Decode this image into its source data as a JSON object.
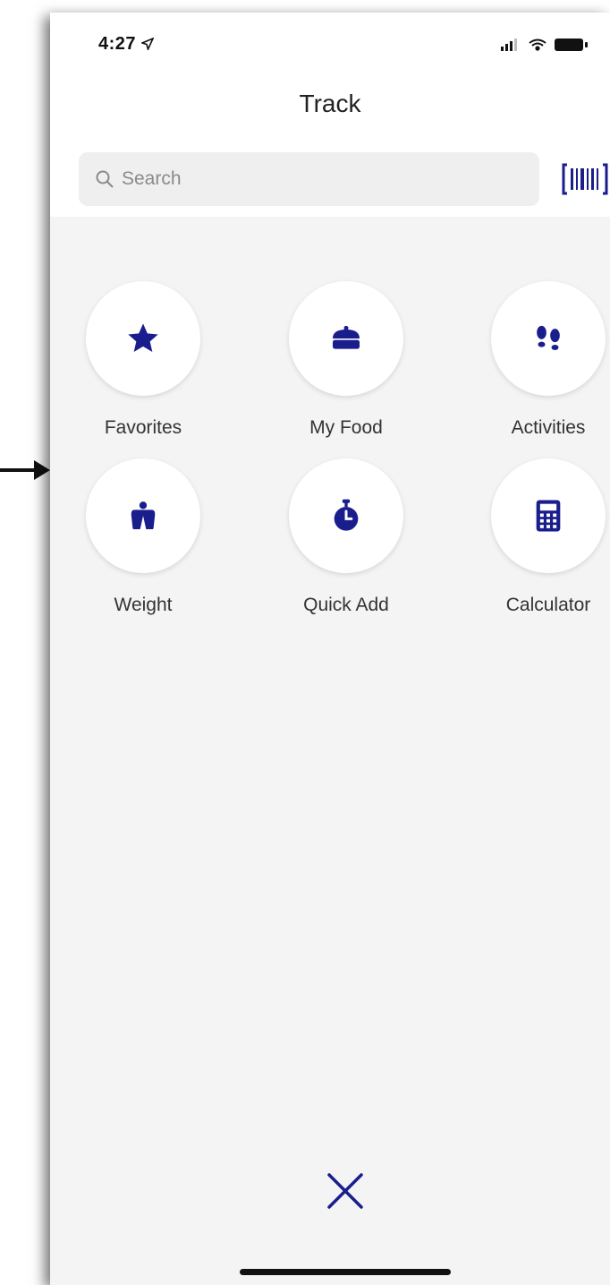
{
  "colors": {
    "accent": "#1a1e8c",
    "background": "#f4f4f4",
    "header_background": "#ffffff"
  },
  "status_bar": {
    "time": "4:27",
    "icons": [
      "location-arrow-icon",
      "signal-icon",
      "wifi-icon",
      "battery-icon"
    ]
  },
  "header": {
    "title": "Track"
  },
  "search": {
    "placeholder": "Search",
    "value": "",
    "scan_icon": "barcode-scan-icon"
  },
  "tiles": [
    {
      "label": "Favorites",
      "icon": "star-icon"
    },
    {
      "label": "My Food",
      "icon": "cooking-pot-icon"
    },
    {
      "label": "Activities",
      "icon": "footprints-icon"
    },
    {
      "label": "Weight",
      "icon": "weight-icon"
    },
    {
      "label": "Quick Add",
      "icon": "stopwatch-icon"
    },
    {
      "label": "Calculator",
      "icon": "calculator-icon"
    }
  ],
  "footer": {
    "close_icon": "close-icon"
  }
}
